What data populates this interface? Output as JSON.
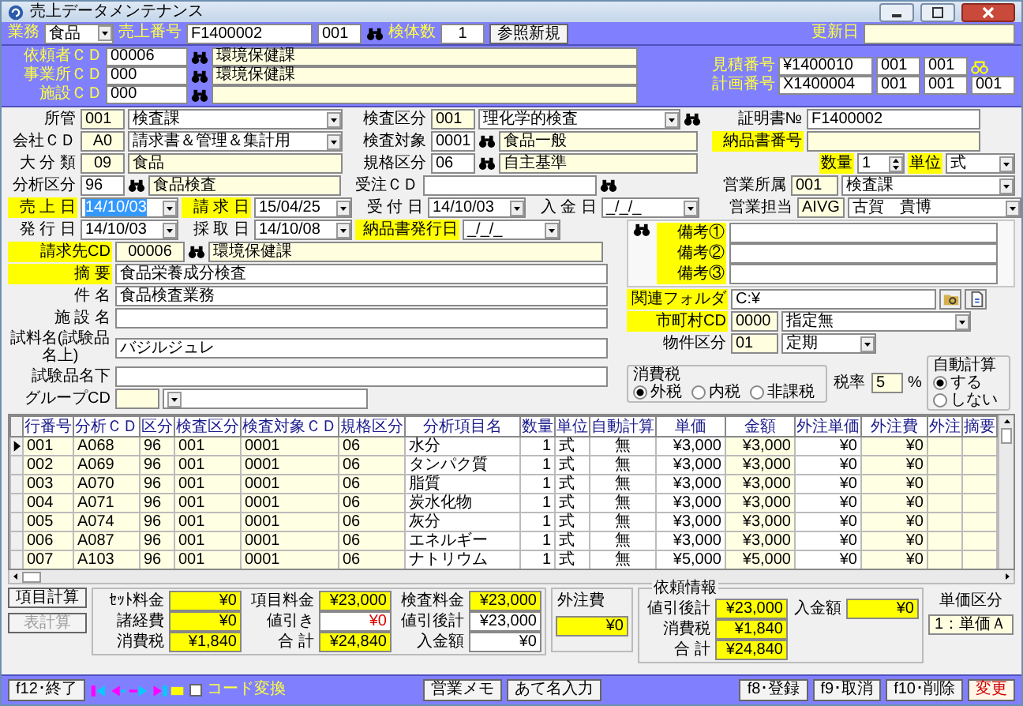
{
  "window": {
    "title": "売上データメンテナンス"
  },
  "header": {
    "business": {
      "label": "業務",
      "value": "食品"
    },
    "sales_no": {
      "label": "売上番号",
      "value": "F1400002",
      "branch": "001"
    },
    "sample_count": {
      "label": "検体数",
      "value": "1"
    },
    "reference_button": "参照新規",
    "updated": {
      "label": "更新日"
    }
  },
  "client": {
    "rows": [
      {
        "label": "依頼者ＣＤ",
        "code": "00006",
        "name": "環境保健課"
      },
      {
        "label": "事業所ＣＤ",
        "code": "000",
        "name": "環境保健課"
      },
      {
        "label": "施設ＣＤ",
        "code": "000"
      }
    ],
    "estimate": {
      "label": "見積番号",
      "values": [
        "¥1400010",
        "001",
        "001"
      ]
    },
    "plan": {
      "label": "計画番号",
      "values": [
        "X1400004",
        "001",
        "001",
        "001"
      ]
    }
  },
  "form": {
    "jurisdiction": {
      "label": "所管",
      "required": false,
      "code": "001",
      "value": "検査課"
    },
    "inspection_type": {
      "label": "検査区分",
      "required": false,
      "code": "001",
      "value": "理化学的検査"
    },
    "certificate_no": {
      "label": "証明書№",
      "required": false,
      "value": "F1400002"
    },
    "company": {
      "label": "会社ＣＤ",
      "required": false,
      "code": "A0",
      "value": "請求書＆管理＆集計用"
    },
    "inspection_target": {
      "label": "検査対象",
      "required": false,
      "code": "0001",
      "value": "食品一般"
    },
    "delivery_no": {
      "label": "納品書番号",
      "required": true
    },
    "category": {
      "label": "大 分 類",
      "required": false,
      "code": "09",
      "value": "食品"
    },
    "standard": {
      "label": "規格区分",
      "required": false,
      "code": "06",
      "value": "自主基準"
    },
    "quantity": {
      "label": "数量",
      "required": true,
      "value": "1"
    },
    "unit": {
      "label": "単位",
      "required": true,
      "value": "式"
    },
    "analysis_type": {
      "label": "分析区分",
      "required": false,
      "code": "96",
      "value": "食品検査"
    },
    "order_cd": {
      "label": "受注ＣＤ",
      "required": false
    },
    "sales_dept": {
      "label": "営業所属",
      "required": false,
      "code": "001",
      "value": "検査課"
    },
    "sales_rep": {
      "label": "営業担当",
      "required": false,
      "code": "AIVG",
      "value": "古賀　貴博"
    },
    "dates": [
      {
        "label": "売 上 日",
        "required": true,
        "value": "14/10/03",
        "focused": true
      },
      {
        "label": "請 求 日",
        "required": true,
        "value": "15/04/25",
        "focused": false
      },
      {
        "label": "受 付 日",
        "required": false,
        "value": "14/10/03",
        "focused": false
      },
      {
        "label": "入 金 日",
        "required": false,
        "value": "_/_/_",
        "focused": false
      },
      {
        "label": "発 行 日",
        "required": false,
        "value": "14/10/03",
        "focused": false
      },
      {
        "label": "採 取 日",
        "required": false,
        "value": "14/10/08",
        "focused": false
      },
      {
        "label": "納品書発行日",
        "required": true,
        "value": "_/_/_",
        "focused": false
      }
    ],
    "billing": {
      "label": "請求先CD",
      "required": true,
      "code": "00006",
      "value": "環境保健課"
    },
    "summary": {
      "label": "摘 要",
      "required": true,
      "value": "食品栄養成分検査"
    },
    "subject": {
      "label": "件 名",
      "required": false,
      "value": "食品検査業務"
    },
    "facility": {
      "label": "施 設 名",
      "required": false
    },
    "sample_upper": {
      "label": "試料名(試験品名上)",
      "required": false,
      "value": "バジルジュレ"
    },
    "sample_lower": {
      "label": "試験品名下",
      "required": false
    },
    "group": {
      "label": "グループCD",
      "required": false
    },
    "notes": [
      {
        "label": "備考①",
        "required": true
      },
      {
        "label": "備考②",
        "required": true
      },
      {
        "label": "備考③",
        "required": true
      }
    ],
    "folder": {
      "label": "関連フォルダ",
      "required": true,
      "value": "C:¥"
    },
    "municipality": {
      "label": "市町村CD",
      "required": true,
      "code": "0000",
      "value": "指定無"
    },
    "property_type": {
      "label": "物件区分",
      "required": false,
      "code": "01",
      "value": "定期"
    },
    "tax": {
      "label": "消費税",
      "options": [
        {
          "label": "外税",
          "selected": true
        },
        {
          "label": "内税",
          "selected": false
        },
        {
          "label": "非課税",
          "selected": false
        }
      ]
    },
    "tax_rate": {
      "label": "税率",
      "value": "5",
      "unit": "%"
    },
    "auto_calc": {
      "label": "自動計算",
      "options": [
        {
          "label": "する",
          "selected": true
        },
        {
          "label": "しない",
          "selected": false
        }
      ]
    }
  },
  "table": {
    "columns": [
      "行番号",
      "分析ＣＤ",
      "区分",
      "検査区分",
      "検査対象ＣＤ",
      "規格区分",
      "分析項目名",
      "数量",
      "単位",
      "自動計算",
      "単価",
      "金額",
      "外注単価",
      "外注費",
      "外注",
      "摘要"
    ],
    "rows": [
      {
        "current": true,
        "cells": [
          "001",
          "A068",
          "96",
          "001",
          "0001",
          "06",
          "水分",
          "1",
          "式",
          "無",
          "¥3,000",
          "¥3,000",
          "¥0",
          "¥0"
        ]
      },
      {
        "current": false,
        "cells": [
          "002",
          "A069",
          "96",
          "001",
          "0001",
          "06",
          "タンパク質",
          "1",
          "式",
          "無",
          "¥3,000",
          "¥3,000",
          "¥0",
          "¥0"
        ]
      },
      {
        "current": false,
        "cells": [
          "003",
          "A070",
          "96",
          "001",
          "0001",
          "06",
          "脂質",
          "1",
          "式",
          "無",
          "¥3,000",
          "¥3,000",
          "¥0",
          "¥0"
        ]
      },
      {
        "current": false,
        "cells": [
          "004",
          "A071",
          "96",
          "001",
          "0001",
          "06",
          "炭水化物",
          "1",
          "式",
          "無",
          "¥3,000",
          "¥3,000",
          "¥0",
          "¥0"
        ]
      },
      {
        "current": false,
        "cells": [
          "005",
          "A074",
          "96",
          "001",
          "0001",
          "06",
          "灰分",
          "1",
          "式",
          "無",
          "¥3,000",
          "¥3,000",
          "¥0",
          "¥0"
        ]
      },
      {
        "current": false,
        "cells": [
          "006",
          "A087",
          "96",
          "001",
          "0001",
          "06",
          "エネルギー",
          "1",
          "式",
          "無",
          "¥3,000",
          "¥3,000",
          "¥0",
          "¥0"
        ]
      },
      {
        "current": false,
        "cells": [
          "007",
          "A103",
          "96",
          "001",
          "0001",
          "06",
          "ナトリウム",
          "1",
          "式",
          "無",
          "¥5,000",
          "¥5,000",
          "¥0",
          "¥0"
        ]
      }
    ]
  },
  "totals": {
    "buttons": [
      {
        "label": "項目計算",
        "disabled": false
      },
      {
        "label": "表計算",
        "disabled": true
      }
    ],
    "columns": [
      [
        {
          "label": "ｾｯﾄ料金",
          "value": "¥0",
          "kind": "total"
        },
        {
          "label": "諸経費",
          "value": "¥0",
          "kind": "total"
        },
        {
          "label": "消費税",
          "value": "¥1,840",
          "kind": "total"
        }
      ],
      [
        {
          "label": "項目料金",
          "value": "¥23,000",
          "kind": "total"
        },
        {
          "label": "値引き",
          "value": "¥0",
          "kind": "discount"
        },
        {
          "label": "合 計",
          "value": "¥24,840",
          "kind": "total"
        }
      ],
      [
        {
          "label": "検査料金",
          "value": "¥23,000",
          "kind": "total"
        },
        {
          "label": "値引後計",
          "value": "¥23,000",
          "kind": "input"
        },
        {
          "label": "入金額",
          "value": "¥0",
          "kind": "input"
        }
      ]
    ],
    "outsourcing": {
      "label": "外注費",
      "value": "¥0"
    },
    "request_info": {
      "title": "依頼情報",
      "fields": [
        {
          "label": "値引後計",
          "value": "¥23,000"
        },
        {
          "label": "消費税",
          "value": "¥1,840"
        },
        {
          "label": "合 計",
          "value": "¥24,840"
        }
      ],
      "deposit": {
        "label": "入金額",
        "value": "¥0"
      }
    },
    "price_class": {
      "label": "単価区分",
      "value": "1：単価Ａ"
    }
  },
  "footer": {
    "exit": "f12･終了",
    "code_convert": {
      "label": "コード変換",
      "checked": false
    },
    "buttons": [
      "営業メモ",
      "あて名入力"
    ],
    "actions": [
      {
        "label": "f8･登録",
        "kind": "normal"
      },
      {
        "label": "f9･取消",
        "kind": "normal"
      },
      {
        "label": "f10･削除",
        "kind": "normal"
      },
      {
        "label": "変更",
        "kind": "primary"
      }
    ]
  }
}
